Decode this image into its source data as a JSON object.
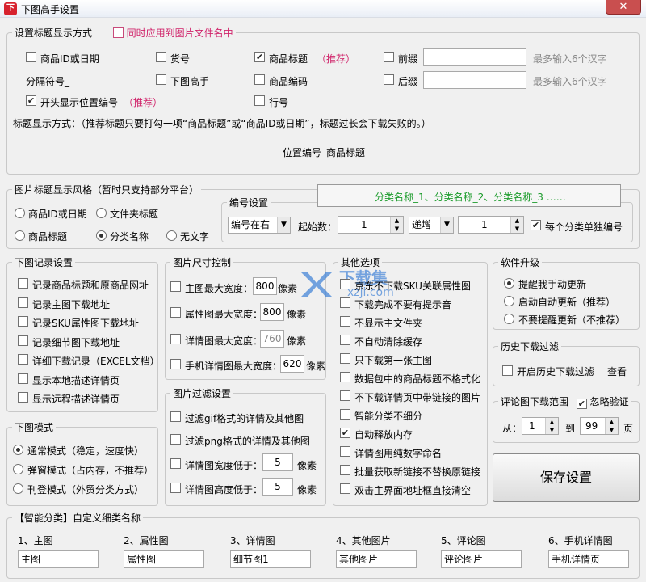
{
  "window": {
    "title": "下图高手设置",
    "app_icon": "app-logo-icon",
    "close_glyph": "✕"
  },
  "title_display": {
    "legend": "设置标题显示方式",
    "apply_to_filename": "同时应用到图片文件名中",
    "chk_product_id": "商品ID或日期",
    "chk_item_no": "货号",
    "chk_product_title": "商品标题",
    "recommend": "（推荐）",
    "chk_prefix": "前缀",
    "prefix_hint": "最多输入6个汉字",
    "separator": "分隔符号_",
    "chk_downloader": "下图高手",
    "chk_product_code": "商品编码",
    "chk_suffix": "后缀",
    "suffix_hint": "最多输入6个汉字",
    "chk_position_prefix": "开头显示位置编号",
    "chk_row_no": "行号",
    "note": "标题显示方式：（推荐标题只要打勾一项“商品标题”或“商品ID或日期”，标题过长会下载失败的。）",
    "preview": "位置编号_商品标题"
  },
  "style_group": {
    "legend": "图片标题显示风格（暂时只支持部分平台）",
    "opt_product_id": "商品ID或日期",
    "opt_folder_title": "文件夹标题",
    "opt_product_title": "商品标题",
    "opt_category": "分类名称",
    "opt_no_text": "无文字",
    "numbering_legend": "编号设置",
    "category_preview": "分类名称_1、分类名称_2、分类名称_3 ……",
    "numbering_position": "编号在右",
    "start_label": "起始数：",
    "start_value": "1",
    "increment_mode": "递增",
    "increment_value": "1",
    "per_category_numbering": "每个分类单独编号"
  },
  "record_settings": {
    "legend": "下图记录设置",
    "items": [
      "记录商品标题和原商品网址",
      "记录主图下载地址",
      "记录SKU属性图下载地址",
      "记录细节图下载地址",
      "详细下载记录（EXCEL文档）",
      "显示本地描述详情页",
      "显示远程描述详情页"
    ]
  },
  "size_control": {
    "legend": "图片尺寸控制",
    "unit": "像素",
    "items": [
      {
        "label": "主图最大宽度：",
        "value": "800"
      },
      {
        "label": "属性图最大宽度：",
        "value": "800"
      },
      {
        "label": "详情图最大宽度：",
        "value": "760"
      },
      {
        "label": "手机详情图最大宽度：",
        "value": "620"
      }
    ]
  },
  "filter_settings": {
    "legend": "图片过滤设置",
    "gif": "过滤gif格式的详情及其他图",
    "png": "过滤png格式的详情及其他图",
    "width_label": "详情图宽度低于：",
    "width_value": "5",
    "height_label": "详情图高度低于：",
    "height_value": "5",
    "unit": "像素"
  },
  "other_options": {
    "legend": "其他选项",
    "items": [
      "京东不下载SKU关联属性图",
      "下载完成不要有提示音",
      "不显示主文件夹",
      "不自动清除缓存",
      "只下载第一张主图",
      "数据包中的商品标题不格式化",
      "不下载详情页中带链接的图片",
      "智能分类不细分",
      "自动释放内存",
      "详情图用纯数字命名",
      "批量获取新链接不替换原链接",
      "双击主界面地址框直接清空"
    ],
    "watermark_text": "下载集",
    "watermark_url": "xzji.com"
  },
  "upgrade": {
    "legend": "软件升级",
    "opt_manual": "提醒我手动更新",
    "opt_auto": "启动自动更新（推荐）",
    "opt_never": "不要提醒更新（不推荐）"
  },
  "history": {
    "legend": "历史下载过滤",
    "enable": "开启历史下载过滤",
    "view": "查看"
  },
  "review_range": {
    "legend": "评论图下载范围",
    "ignore_check": "忽略验证",
    "from_label": "从：",
    "from_value": "1",
    "to_label": "到",
    "to_value": "99",
    "page_label": "页"
  },
  "save_button": "保存设置",
  "mode": {
    "legend": "下图模式",
    "normal": "通常模式（稳定，速度快）",
    "popup": "弹窗模式（占内存，不推荐）",
    "magazine": "刊登模式（外贸分类方式）"
  },
  "smart_category": {
    "legend": "【智能分类】自定义细类名称",
    "items": [
      {
        "label": "1、主图",
        "value": "主图"
      },
      {
        "label": "2、属性图",
        "value": "属性图"
      },
      {
        "label": "3、详情图",
        "value": "细节图1"
      },
      {
        "label": "4、其他图片",
        "value": "其他图片"
      },
      {
        "label": "5、评论图",
        "value": "评论图片"
      },
      {
        "label": "6、手机详情图",
        "value": "手机详情页"
      }
    ]
  },
  "colors": {
    "accent_red": "#d0236a",
    "green": "#1a9b2a",
    "close_red": "#c94f4f"
  }
}
